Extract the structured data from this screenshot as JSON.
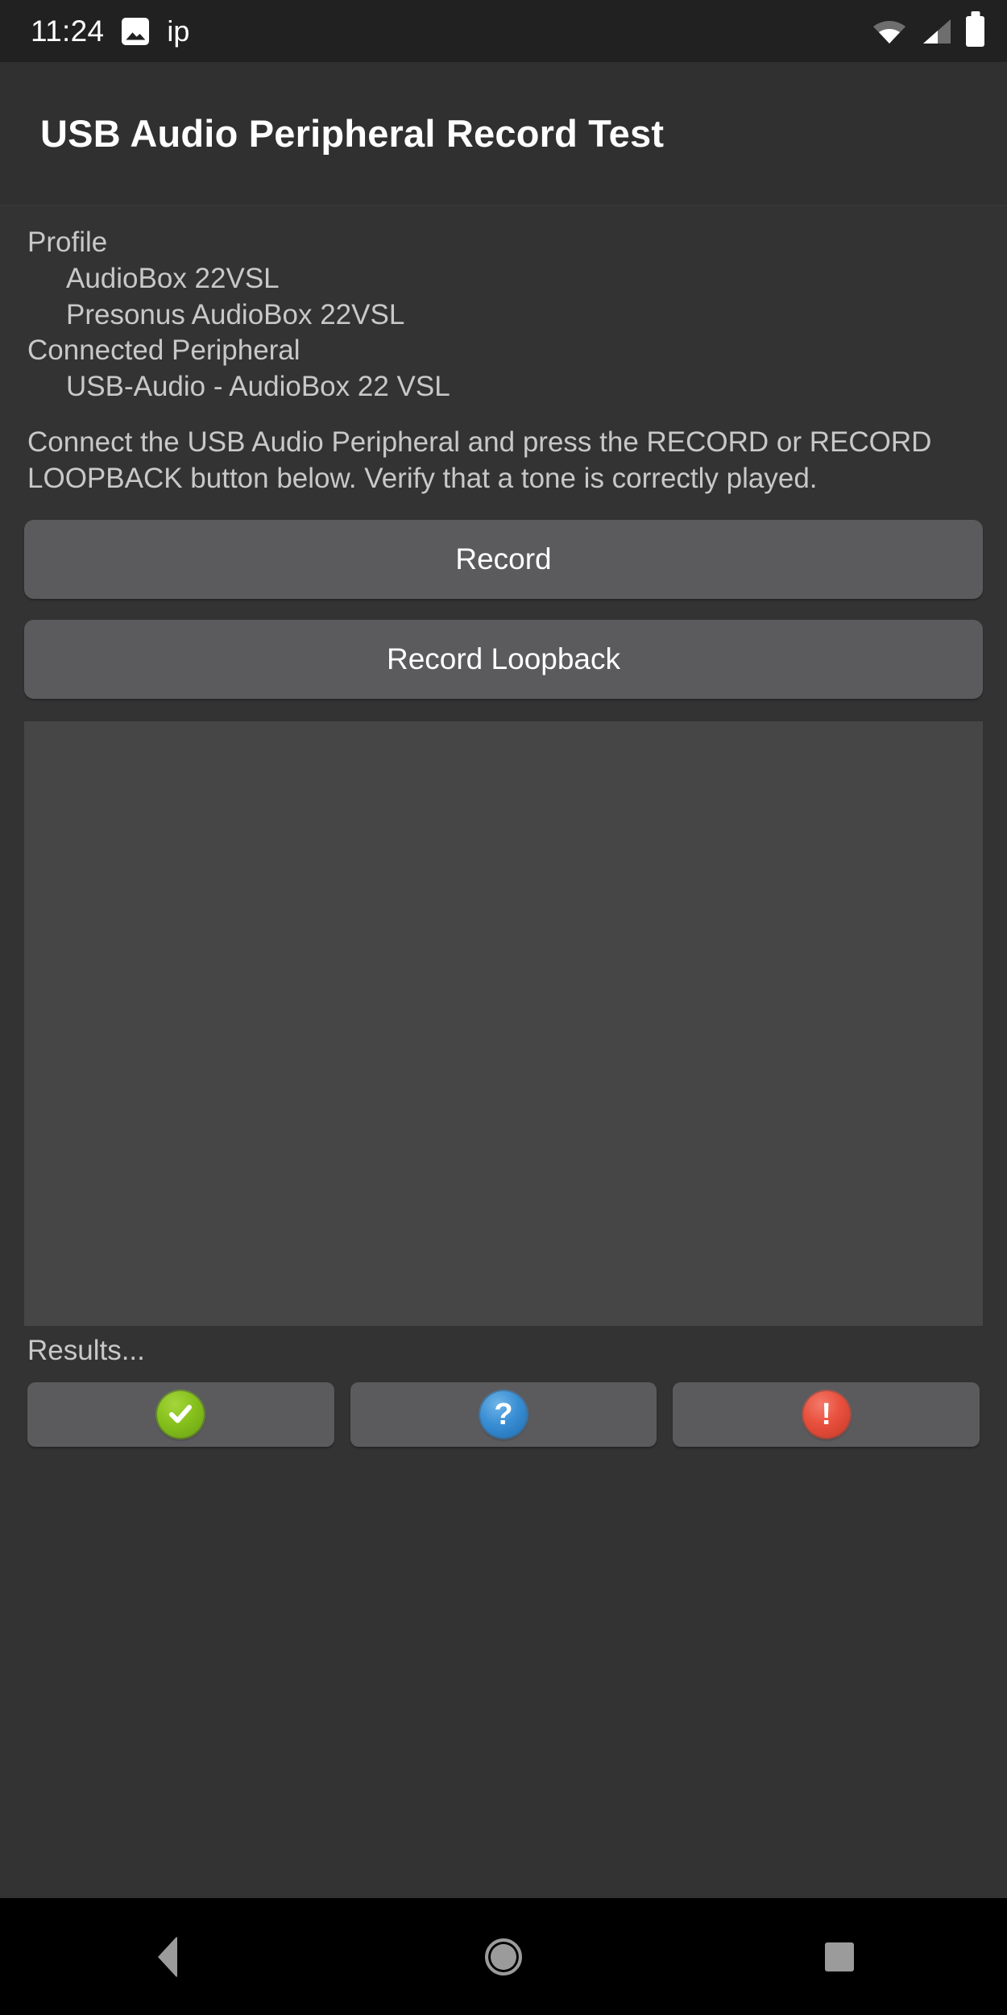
{
  "status_bar": {
    "clock": "11:24",
    "app_label": "ip",
    "icons": [
      "photo-icon",
      "wifi-icon",
      "cellular-signal-icon",
      "battery-icon"
    ]
  },
  "app_bar": {
    "title": "USB Audio Peripheral Record Test"
  },
  "info": {
    "profile_label": "Profile",
    "profile_name": "AudioBox 22VSL",
    "profile_product": "Presonus AudioBox 22VSL",
    "connected_label": "Connected Peripheral",
    "connected_device": "USB-Audio - AudioBox 22 VSL"
  },
  "instructions": {
    "text": "Connect the USB Audio Peripheral and press the RECORD or RECORD LOOPBACK button below. Verify that a tone is correctly played."
  },
  "actions": {
    "record_label": "Record",
    "record_loopback_label": "Record Loopback"
  },
  "log": {
    "text": ""
  },
  "results": {
    "label": "Results...",
    "buttons": [
      {
        "name": "pass",
        "glyph": "✔",
        "color": "#86c11d"
      },
      {
        "name": "info",
        "glyph": "?",
        "color": "#3a8fd4"
      },
      {
        "name": "fail",
        "glyph": "!",
        "color": "#e8503c"
      }
    ]
  },
  "nav_bar": {
    "back_label": "Back",
    "home_label": "Home",
    "recents_label": "Recents"
  },
  "theme": {
    "background": "#333333",
    "status_bar_bg": "#212121",
    "app_bar_bg": "#303030",
    "button_bg": "#5b5b5e",
    "panel_bg": "#464646",
    "text_primary": "#ffffff",
    "text_secondary": "#c8c8c8",
    "nav_bg": "#000000"
  }
}
